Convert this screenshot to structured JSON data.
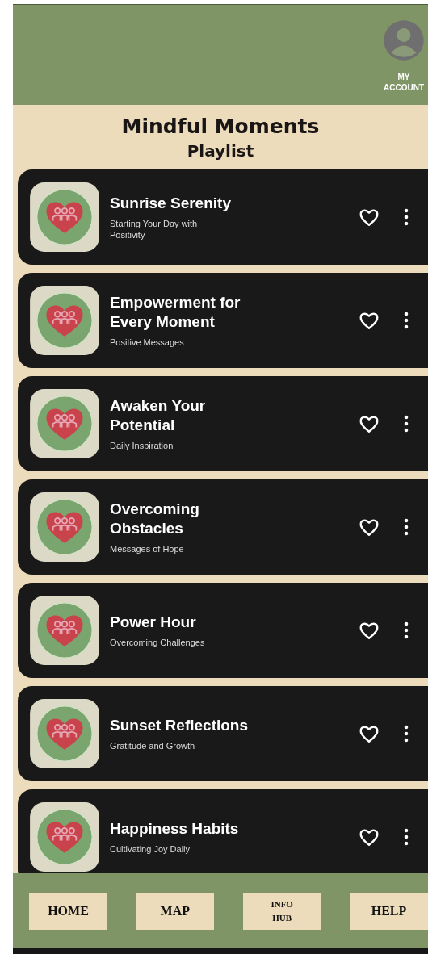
{
  "header": {
    "account_label": "MY ACCOUNT"
  },
  "title": "Mindful Moments",
  "subtitle": "Playlist",
  "tracks": [
    {
      "title": "Sunrise Serenity",
      "subtitle": "Starting Your Day with Positivity"
    },
    {
      "title": "Empowerment for Every Moment",
      "subtitle": "Positive Messages"
    },
    {
      "title": "Awaken Your Potential",
      "subtitle": "Daily Inspiration"
    },
    {
      "title": "Overcoming Obstacles",
      "subtitle": "Messages of Hope"
    },
    {
      "title": "Power Hour",
      "subtitle": "Overcoming Challenges"
    },
    {
      "title": "Sunset Reflections",
      "subtitle": "Gratitude and Growth"
    },
    {
      "title": "Happiness Habits",
      "subtitle": "Cultivating Joy Daily"
    }
  ],
  "nav": [
    "HOME",
    "MAP",
    "INFO HUB",
    "HELP"
  ]
}
